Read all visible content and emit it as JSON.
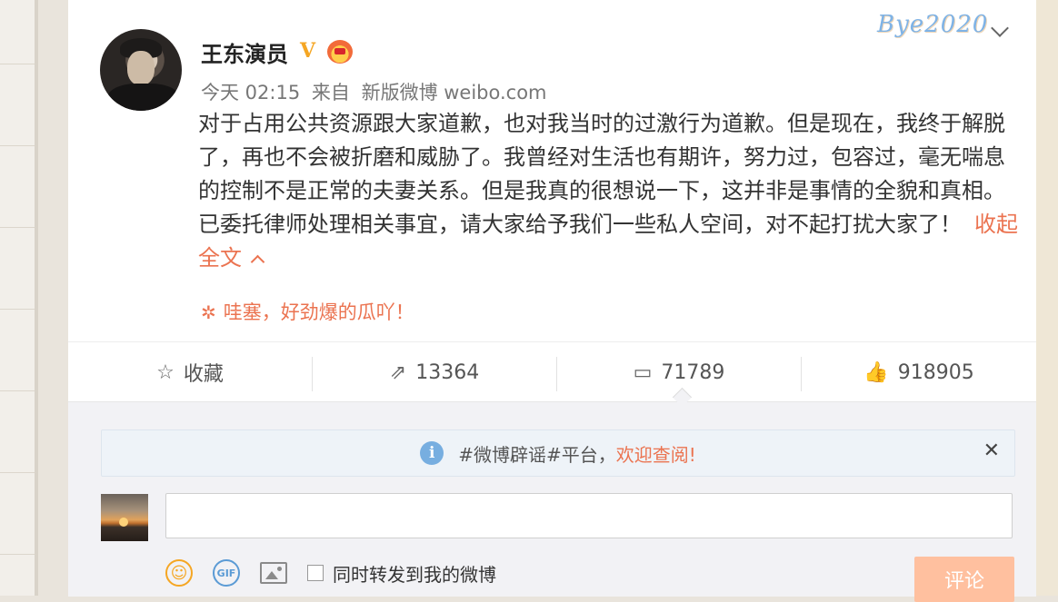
{
  "post": {
    "author": "王东演员",
    "verified_badge": "V",
    "time": "今天 02:15",
    "source_prefix": "来自",
    "source": "新版微博 weibo.com",
    "text": "对于占用公共资源跟大家道歉，也对我当时的过激行为道歉。但是现在，我终于解脱了，再也不会被折磨和威胁了。我曾经对生活也有期许，努力过，包容过，毫无喘息的控制不是正常的夫妻关系。但是我真的很想说一下，这并非是事情的全貌和真相。已委托律师处理相关事宜，请大家给予我们一些私人空间，对不起打扰大家了！",
    "collapse_label": "收起全文",
    "promo": "哇塞，好劲爆的瓜吖！",
    "decoration_text": "Bye2020"
  },
  "actions": {
    "favorite_label": "收藏",
    "repost_count": "13364",
    "comment_count": "71789",
    "like_count": "918905"
  },
  "comment_box": {
    "notice_prefix": "#微博辟谣#平台，",
    "notice_link": "欢迎查阅!",
    "close_symbol": "✕",
    "input_value": "",
    "repost_option": "同时转发到我的微博",
    "submit_label": "评论"
  },
  "icons": {
    "favorite": "star-icon",
    "repost": "repost-icon",
    "comment": "comment-icon",
    "like": "thumb-up-icon",
    "notice": "info-icon",
    "emoji": "emoji-icon",
    "gif": "gif-icon",
    "image": "image-icon"
  },
  "colors": {
    "accent_orange": "#eb7350",
    "submit_disabled": "#ffc09f",
    "verified_gold": "#f5a623",
    "info_blue": "#77aee0"
  }
}
